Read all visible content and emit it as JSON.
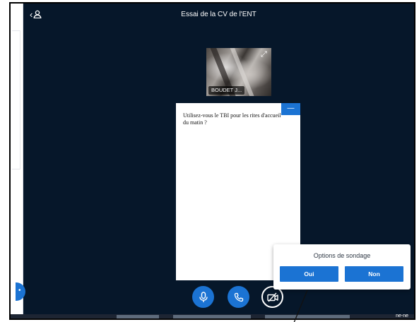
{
  "header": {
    "title": "Essai de la CV de l'ENT",
    "user_list_toggle_icon": "users-toggle-icon"
  },
  "video": {
    "participant_name": "BOUDET J...",
    "expand_icon": "expand-icon"
  },
  "poll": {
    "question": "Utilisez-vous le TBI pour les rites d'accueil du matin ?",
    "minimize_label": "—"
  },
  "poll_options": {
    "heading": "Options de sondage",
    "options": [
      {
        "label": "Oui"
      },
      {
        "label": "Non"
      }
    ]
  },
  "controls": {
    "mic_icon": "microphone-icon",
    "phone_icon": "phone-icon",
    "camera_icon": "camera-off-icon"
  },
  "left_float": {
    "label": "•"
  },
  "taskbar": {
    "label": "ne-ne"
  },
  "colors": {
    "accent": "#1b73d3",
    "stage_background": "#06172a",
    "panel_background": "#ffffff"
  }
}
